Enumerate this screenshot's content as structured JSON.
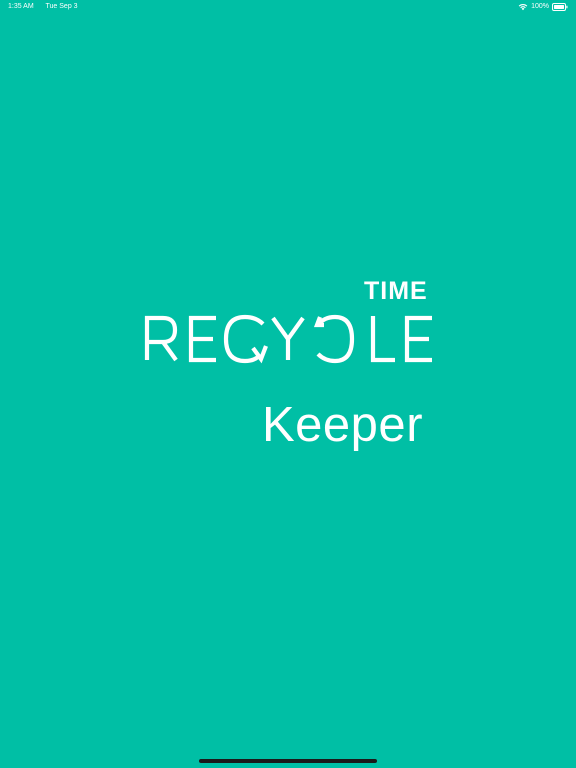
{
  "status_bar": {
    "time": "1:35 AM",
    "date": "Tue Sep 3",
    "battery": "100%",
    "icons": [
      "wifi-icon",
      "battery-icon"
    ]
  },
  "splash": {
    "logo_top": "TIME",
    "logo_main": "RECYCLE",
    "logo_bottom": "Keeper"
  },
  "colors": {
    "background": "#00BFA5",
    "foreground": "#FFFFFF"
  }
}
